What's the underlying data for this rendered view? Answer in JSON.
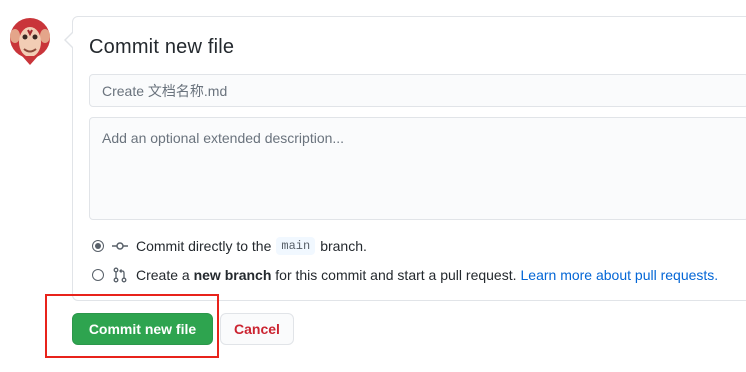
{
  "avatar": {
    "icon": "monkey-avatar-icon"
  },
  "form": {
    "title": "Commit new file",
    "summary_value": "",
    "summary_placeholder": "Create 文档名称.md",
    "description_value": "",
    "description_placeholder": "Add an optional extended description..."
  },
  "options": {
    "direct": {
      "checked": true,
      "icon": "git-commit-icon",
      "text_before": "Commit directly to the",
      "branch": "main",
      "text_after": "branch."
    },
    "new_branch": {
      "checked": false,
      "icon": "git-pull-request-icon",
      "text_before": "Create a",
      "bold": "new branch",
      "text_after": "for this commit and start a pull request.",
      "link": "Learn more about pull requests."
    }
  },
  "buttons": {
    "commit_label": "Commit new file",
    "cancel_label": "Cancel"
  },
  "colors": {
    "commit_green": "#2ea44f",
    "cancel_red": "#cb2431",
    "link_blue": "#0366d6",
    "annotation_red": "#e8231b"
  }
}
